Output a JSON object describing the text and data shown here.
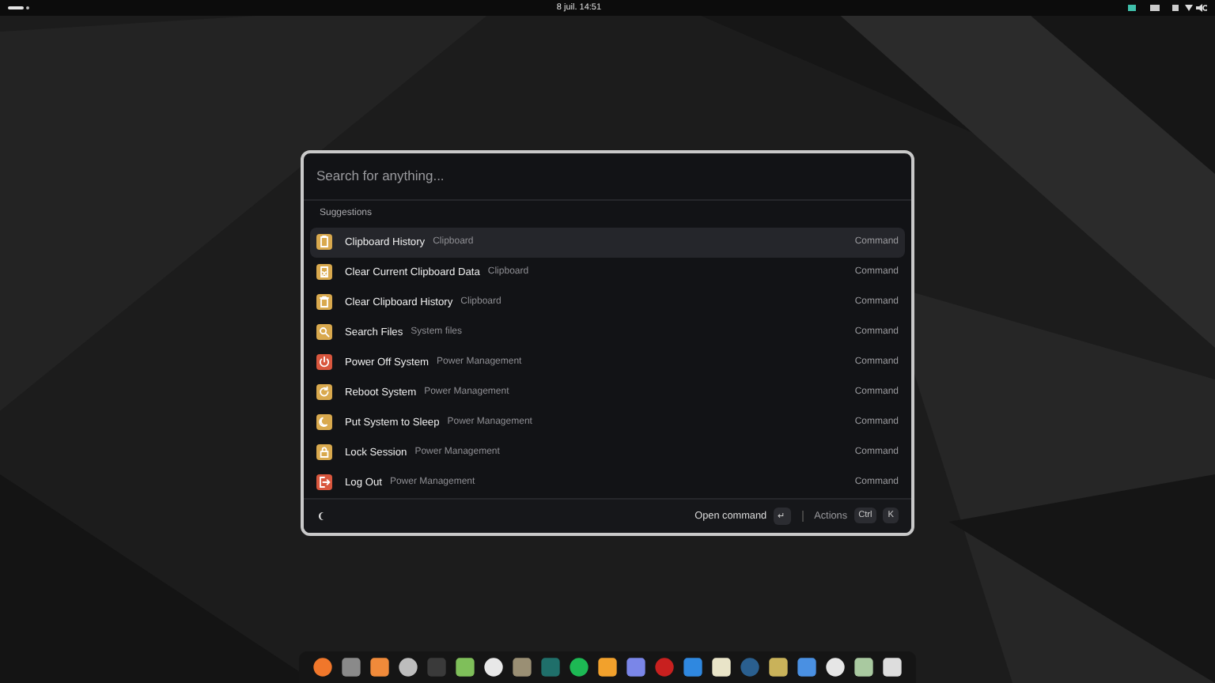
{
  "top_bar": {
    "clock": "8 juil. 14:51"
  },
  "launcher": {
    "search": {
      "placeholder": "Search for anything..."
    },
    "section": "Suggestions",
    "items": [
      {
        "kind": "clipboard",
        "title": "Clipboard History",
        "subtitle": "Clipboard",
        "type": "Command",
        "color": "#d9a94e",
        "selected": true
      },
      {
        "kind": "clear",
        "title": "Clear Current Clipboard Data",
        "subtitle": "Clipboard",
        "type": "Command",
        "color": "#d9a94e",
        "selected": false
      },
      {
        "kind": "trash",
        "title": "Clear Clipboard History",
        "subtitle": "Clipboard",
        "type": "Command",
        "color": "#d9a94e",
        "selected": false
      },
      {
        "kind": "search",
        "title": "Search Files",
        "subtitle": "System files",
        "type": "Command",
        "color": "#d9a94e",
        "selected": false
      },
      {
        "kind": "power",
        "title": "Power Off System",
        "subtitle": "Power Management",
        "type": "Command",
        "color": "#d9573e",
        "selected": false
      },
      {
        "kind": "reboot",
        "title": "Reboot System",
        "subtitle": "Power Management",
        "type": "Command",
        "color": "#d9a94e",
        "selected": false
      },
      {
        "kind": "sleep",
        "title": "Put System to Sleep",
        "subtitle": "Power Management",
        "type": "Command",
        "color": "#d9a94e",
        "selected": false
      },
      {
        "kind": "lock",
        "title": "Lock Session",
        "subtitle": "Power Management",
        "type": "Command",
        "color": "#d9a94e",
        "selected": false
      },
      {
        "kind": "logout",
        "title": "Log Out",
        "subtitle": "Power Management",
        "type": "Command",
        "color": "#d9573e",
        "selected": false
      }
    ],
    "footer": {
      "primary": "Open command",
      "primary_key": "↵",
      "actions": "Actions",
      "keys": [
        "Ctrl",
        "K"
      ]
    }
  },
  "dock": [
    {
      "color": "#f0772b"
    },
    {
      "color": "#8a8a8a"
    },
    {
      "color": "#f08a3a"
    },
    {
      "color": "#bdbdbd"
    },
    {
      "color": "#3a3a3a"
    },
    {
      "color": "#7fbf5a"
    },
    {
      "color": "#e8e8e8"
    },
    {
      "color": "#9a8f74"
    },
    {
      "color": "#1f6f6a"
    },
    {
      "color": "#1db954"
    },
    {
      "color": "#f2a12c"
    },
    {
      "color": "#7a86e8"
    },
    {
      "color": "#c8201f"
    },
    {
      "color": "#2f88e0"
    },
    {
      "color": "#e9e4c8"
    },
    {
      "color": "#2a5f8f"
    },
    {
      "color": "#c9b25a"
    },
    {
      "color": "#4a90e2"
    },
    {
      "color": "#e6e6e6"
    },
    {
      "color": "#a9c9a0"
    },
    {
      "color": "#dddddd"
    }
  ]
}
